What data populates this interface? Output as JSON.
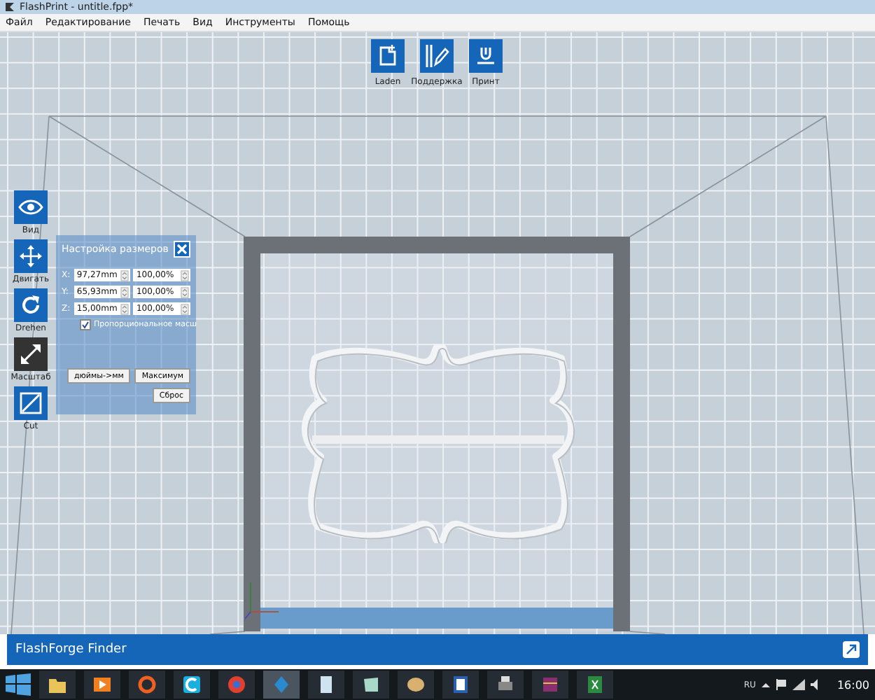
{
  "window": {
    "title": "FlashPrint - untitle.fpp*"
  },
  "menu": [
    "Файл",
    "Редактирование",
    "Печать",
    "Вид",
    "Инструменты",
    "Помощь"
  ],
  "toolbar": [
    {
      "label": "Laden",
      "kind": "load"
    },
    {
      "label": "Поддержка",
      "kind": "support"
    },
    {
      "label": "Принт",
      "kind": "print"
    }
  ],
  "tools": [
    {
      "label": "Вид",
      "kind": "view",
      "selected": false
    },
    {
      "label": "Двигать",
      "kind": "move",
      "selected": false
    },
    {
      "label": "Drehen",
      "kind": "rotate",
      "selected": false
    },
    {
      "label": "Масштаб",
      "kind": "scale",
      "selected": true
    },
    {
      "label": "Cut",
      "kind": "cut",
      "selected": false
    }
  ],
  "scale_dialog": {
    "title": "Настройка размеров",
    "rows": [
      {
        "axis": "X:",
        "size": "97,27mm",
        "percent": "100,00%"
      },
      {
        "axis": "Y:",
        "size": "65,93mm",
        "percent": "100,00%"
      },
      {
        "axis": "Z:",
        "size": "15,00mm",
        "percent": "100,00%"
      }
    ],
    "proportional": {
      "label": "Пропорциональное масш",
      "checked": true
    },
    "buttons": [
      "дюймы->мм",
      "Максимум",
      "Сброс"
    ]
  },
  "status_bar": {
    "title": "FlashForge Finder"
  },
  "taskbar": {
    "language": "RU",
    "time": "16:00"
  }
}
